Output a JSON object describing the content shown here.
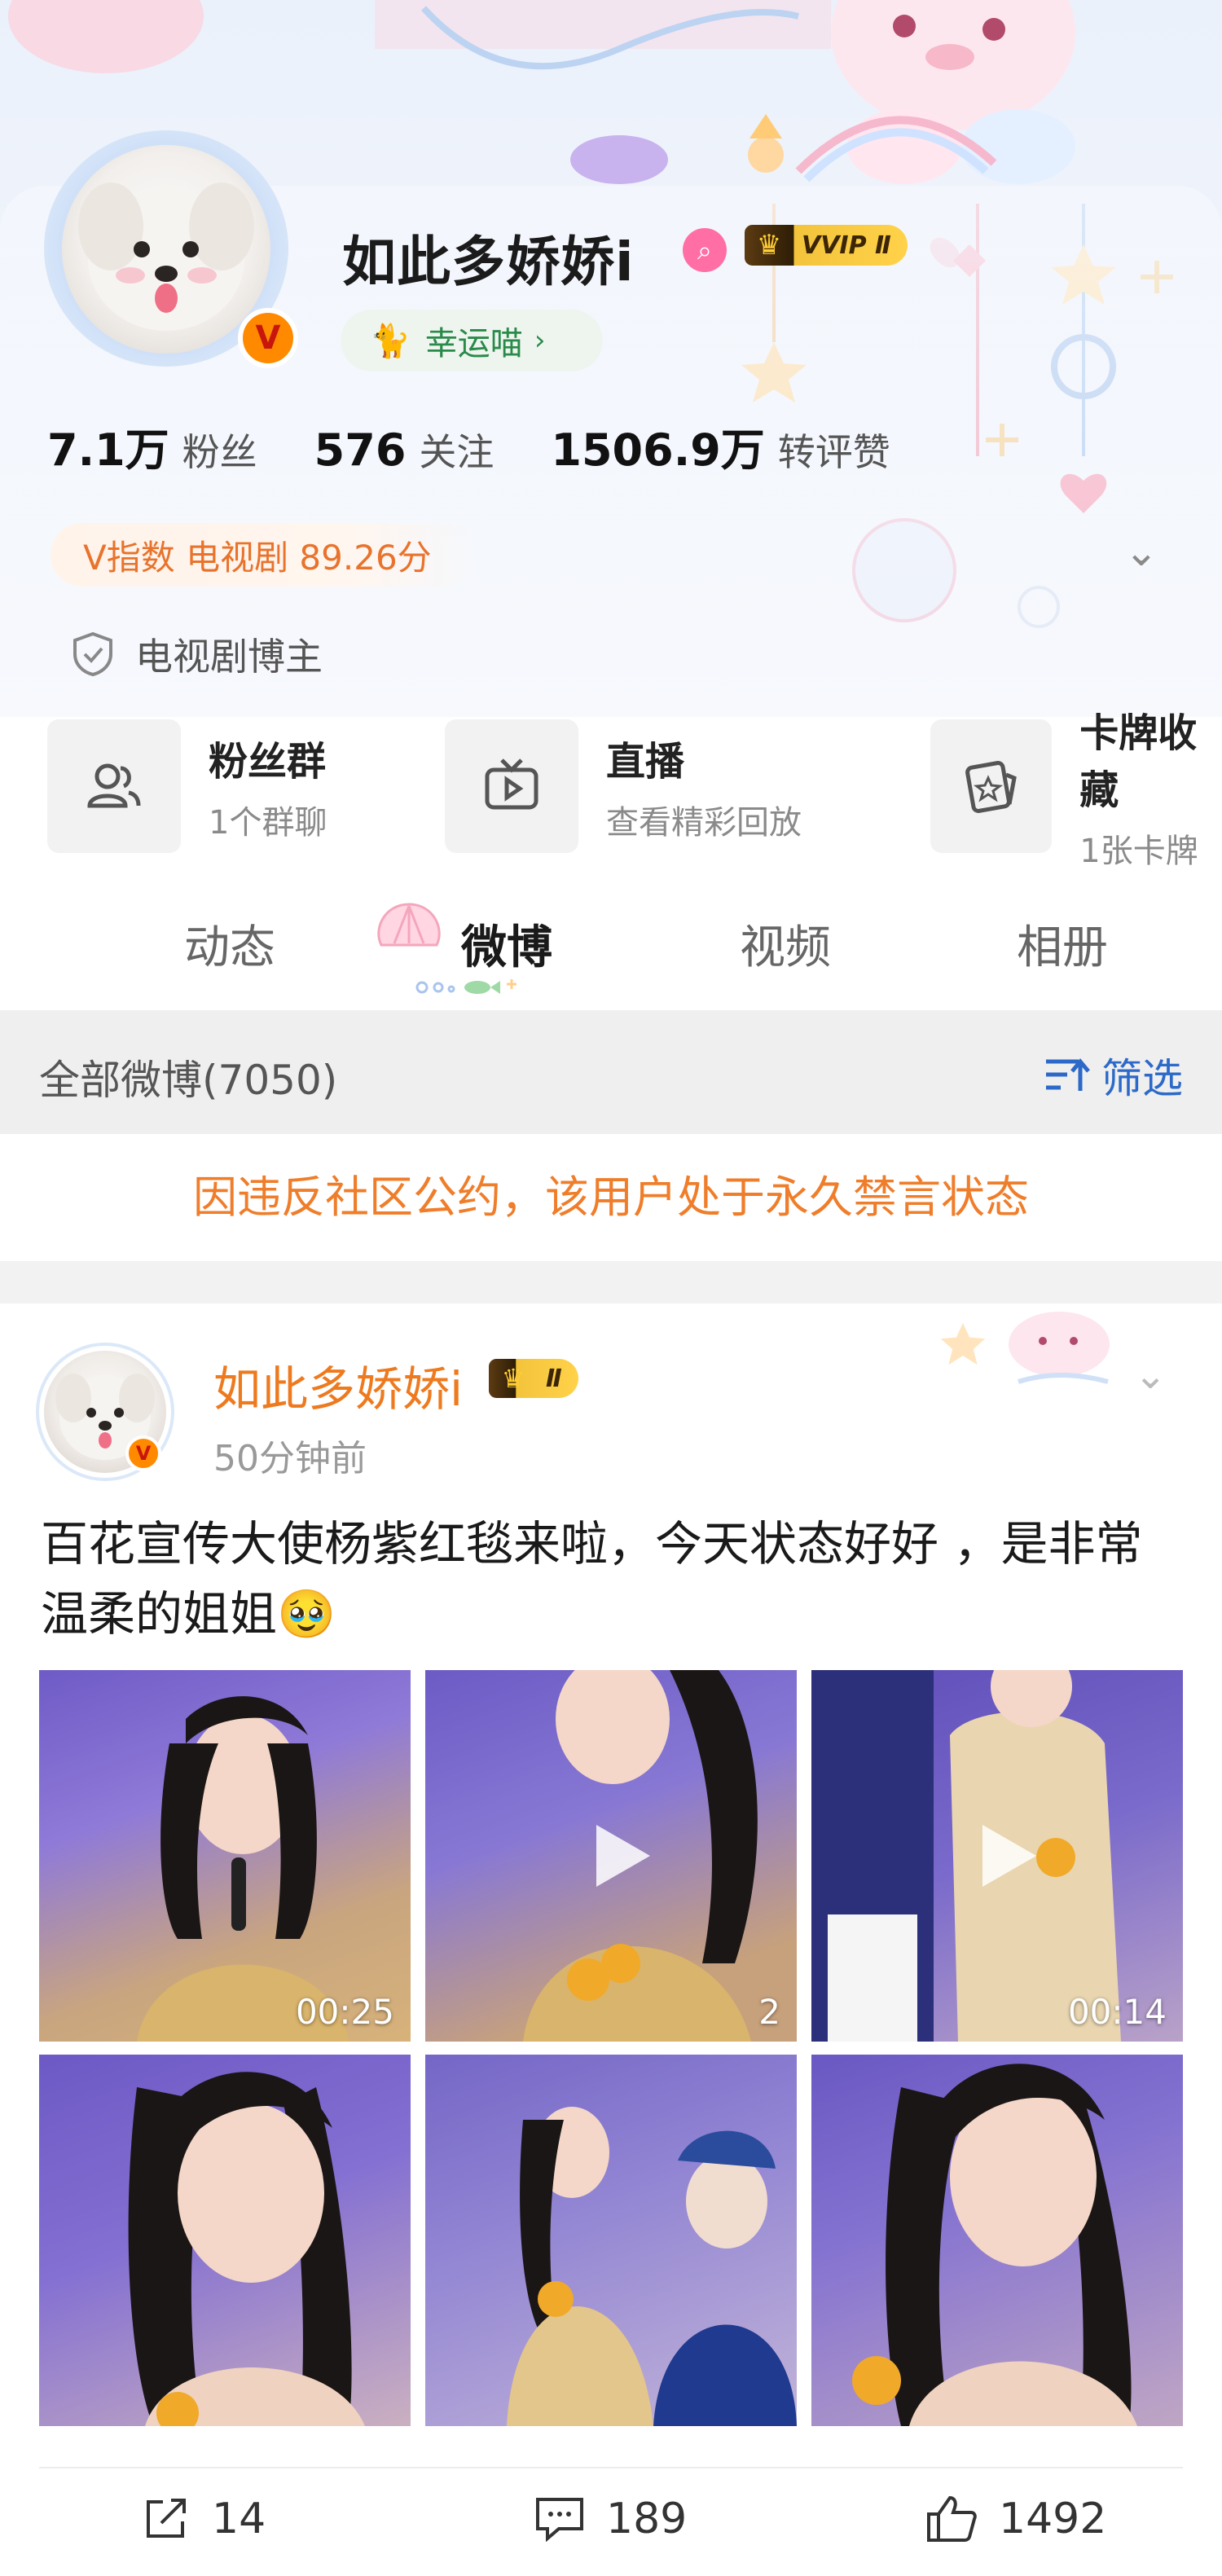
{
  "profile": {
    "username": "如此多娇娇i",
    "vip_level": "VVIP Ⅱ",
    "lucky_tag": "幸运喵",
    "stats": [
      {
        "value": "7.1万",
        "label": "粉丝"
      },
      {
        "value": "576",
        "label": "关注"
      },
      {
        "value": "1506.9万",
        "label": "转评赞"
      }
    ],
    "v_index": "V指数 电视剧 89.26分",
    "identity": "电视剧博主"
  },
  "shortcuts": [
    {
      "title": "粉丝群",
      "sub": "1个群聊",
      "icon": "people-icon"
    },
    {
      "title": "直播",
      "sub": "查看精彩回放",
      "icon": "tv-icon"
    },
    {
      "title": "卡牌收藏",
      "sub": "1张卡牌",
      "icon": "card-icon"
    }
  ],
  "tabs": [
    "动态",
    "微博",
    "视频",
    "相册"
  ],
  "active_tab": "微博",
  "filter": {
    "all_label": "全部微博(7050)",
    "filter_label": "筛选"
  },
  "ban_notice": "因违反社区公约，该用户处于永久禁言状态",
  "post": {
    "author": "如此多娇娇i",
    "vip_level": "Ⅱ",
    "time": "50分钟前",
    "text": "百花宣传大使杨紫红毯来啦，今天状态好好 ，是非常温柔的姐姐🥹",
    "media": [
      {
        "type": "video",
        "duration": "00:25"
      },
      {
        "type": "video",
        "duration": "2"
      },
      {
        "type": "video",
        "duration": "00:14"
      },
      {
        "type": "image",
        "duration": ""
      },
      {
        "type": "image",
        "duration": ""
      },
      {
        "type": "image",
        "duration": ""
      }
    ],
    "actions": {
      "repost": "14",
      "comment": "189",
      "like": "1492"
    }
  },
  "colors": {
    "accent_orange": "#ef7d2a",
    "link_blue": "#2c69c8",
    "lucky_green": "#2a8a4a"
  }
}
